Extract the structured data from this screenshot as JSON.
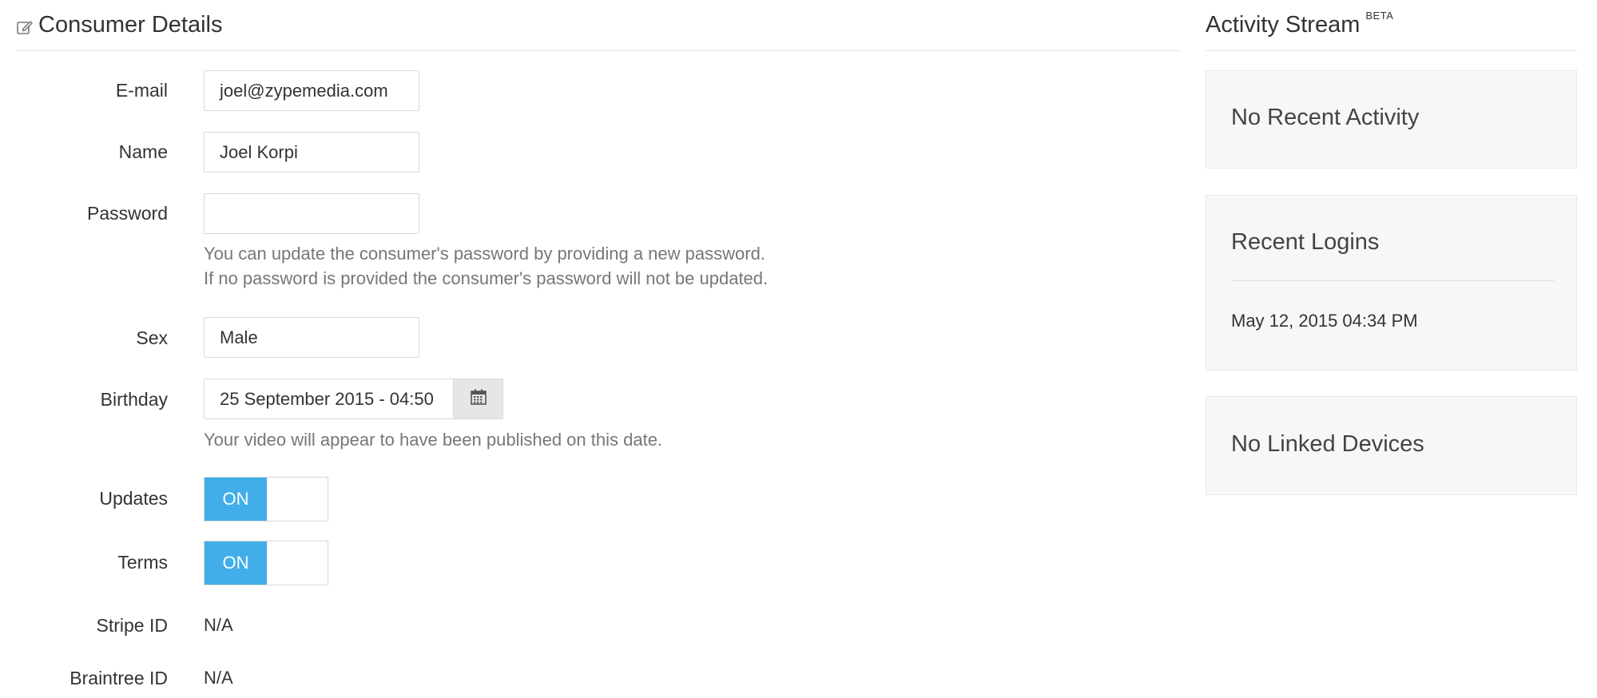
{
  "consumer_details": {
    "title": "Consumer Details",
    "icon": "edit-icon",
    "fields": {
      "email": {
        "label": "E-mail",
        "value": "joel@zypemedia.com"
      },
      "name": {
        "label": "Name",
        "value": "Joel Korpi"
      },
      "password": {
        "label": "Password",
        "value": "",
        "help_line_1": "You can update the consumer's password by providing a new password.",
        "help_line_2": "If no password is provided the consumer's password will not be updated."
      },
      "sex": {
        "label": "Sex",
        "value": "Male"
      },
      "birthday": {
        "label": "Birthday",
        "value": "25 September 2015 - 04:50",
        "icon": "calendar-icon",
        "help": "Your video will appear to have been published on this date."
      },
      "updates": {
        "label": "Updates",
        "toggle_label": "ON",
        "state": true
      },
      "terms": {
        "label": "Terms",
        "toggle_label": "ON",
        "state": true
      },
      "stripe_id": {
        "label": "Stripe ID",
        "value": "N/A"
      },
      "braintree_id": {
        "label": "Braintree ID",
        "value": "N/A"
      }
    }
  },
  "activity_stream": {
    "title": "Activity Stream",
    "badge": "BETA",
    "recent_activity": {
      "title": "No Recent Activity"
    },
    "recent_logins": {
      "title": "Recent Logins",
      "items": [
        "May 12, 2015 04:34 PM"
      ]
    },
    "linked_devices": {
      "title": "No Linked Devices"
    }
  },
  "colors": {
    "toggle_on": "#41aeea",
    "card_bg": "#f7f7f7",
    "help_text": "#777777"
  }
}
